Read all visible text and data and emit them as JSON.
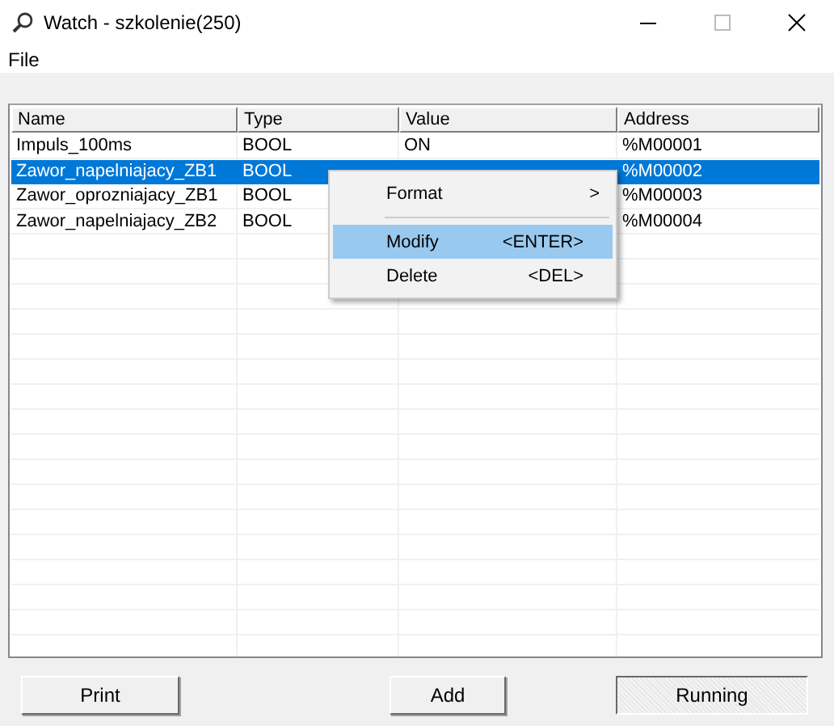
{
  "window": {
    "title": "Watch - szkolenie(250)"
  },
  "menu_bar": [
    "File"
  ],
  "table": {
    "columns": [
      "Name",
      "Type",
      "Value",
      "Address"
    ],
    "rows": [
      {
        "cells": [
          "Impuls_100ms",
          "BOOL",
          "ON",
          "%M00001"
        ],
        "selected": false
      },
      {
        "cells": [
          "Zawor_napelniajacy_ZB1",
          "BOOL",
          "",
          "%M00002"
        ],
        "selected": true
      },
      {
        "cells": [
          "Zawor_oprozniajacy_ZB1",
          "BOOL",
          "",
          "%M00003"
        ],
        "selected": false
      },
      {
        "cells": [
          "Zawor_napelniajacy_ZB2",
          "BOOL",
          "",
          "%M00004"
        ],
        "selected": false
      }
    ]
  },
  "context_menu": {
    "items": [
      {
        "kind": "submenu",
        "label": "Format",
        "arrow": ">",
        "selected": false
      },
      {
        "kind": "separator"
      },
      {
        "kind": "item",
        "label": "Modify",
        "shortcut": "<ENTER>",
        "selected": true
      },
      {
        "kind": "item",
        "label": "Delete",
        "shortcut": "<DEL>",
        "selected": false
      }
    ]
  },
  "buttons": [
    {
      "label": "Print",
      "pressed": false
    },
    {
      "label": "Add",
      "pressed": false
    },
    {
      "label": "Running",
      "pressed": true
    }
  ]
}
